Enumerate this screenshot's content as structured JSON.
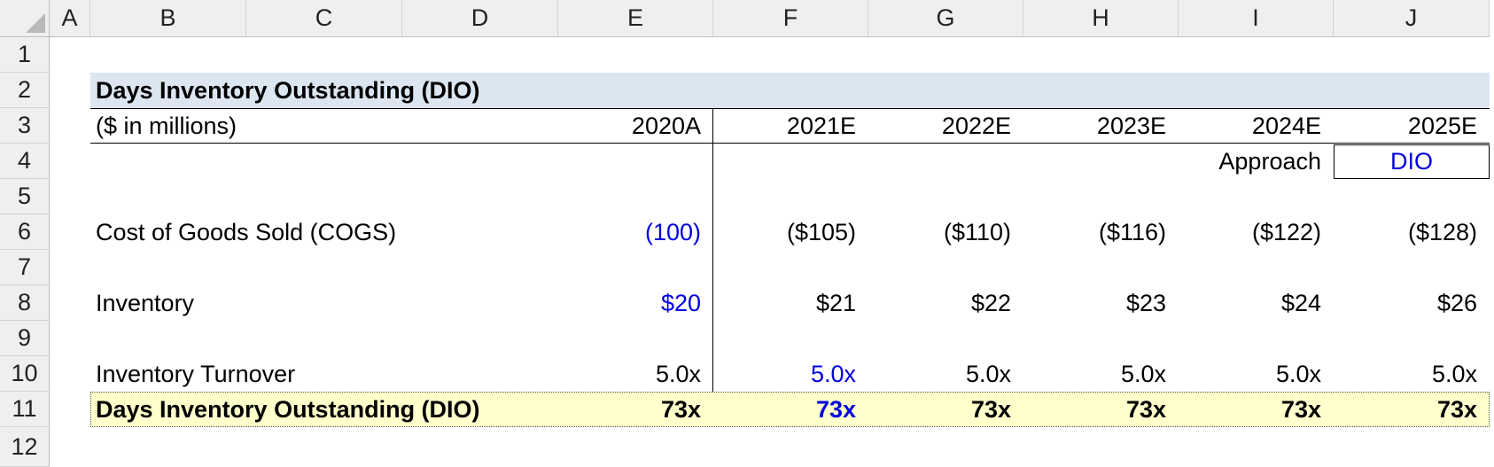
{
  "column_headers": [
    "A",
    "B",
    "C",
    "D",
    "E",
    "F",
    "G",
    "H",
    "I",
    "J"
  ],
  "row_headers": [
    "1",
    "2",
    "3",
    "4",
    "5",
    "6",
    "7",
    "8",
    "9",
    "10",
    "11",
    "12"
  ],
  "title": "Days Inventory Outstanding (DIO)",
  "units_label": "($ in millions)",
  "years": [
    "2020A",
    "2021E",
    "2022E",
    "2023E",
    "2024E",
    "2025E"
  ],
  "approach": {
    "label": "Approach",
    "value": "DIO"
  },
  "rows": {
    "cogs": {
      "label": "Cost of Goods Sold (COGS)",
      "values": [
        "(100)",
        "($105)",
        "($110)",
        "($116)",
        "($122)",
        "($128)"
      ]
    },
    "inventory": {
      "label": "Inventory",
      "values": [
        "$20",
        "$21",
        "$22",
        "$23",
        "$24",
        "$26"
      ]
    },
    "turnover": {
      "label": "Inventory Turnover",
      "values": [
        "5.0x",
        "5.0x",
        "5.0x",
        "5.0x",
        "5.0x",
        "5.0x"
      ]
    },
    "dio": {
      "label": "Days Inventory Outstanding (DIO)",
      "values": [
        "73x",
        "73x",
        "73x",
        "73x",
        "73x",
        "73x"
      ]
    }
  },
  "colors": {
    "header_band": "#dce6f1",
    "dio_band": "#ffffcc",
    "input_blue": "#0000e0",
    "grid_header": "#efefef"
  }
}
